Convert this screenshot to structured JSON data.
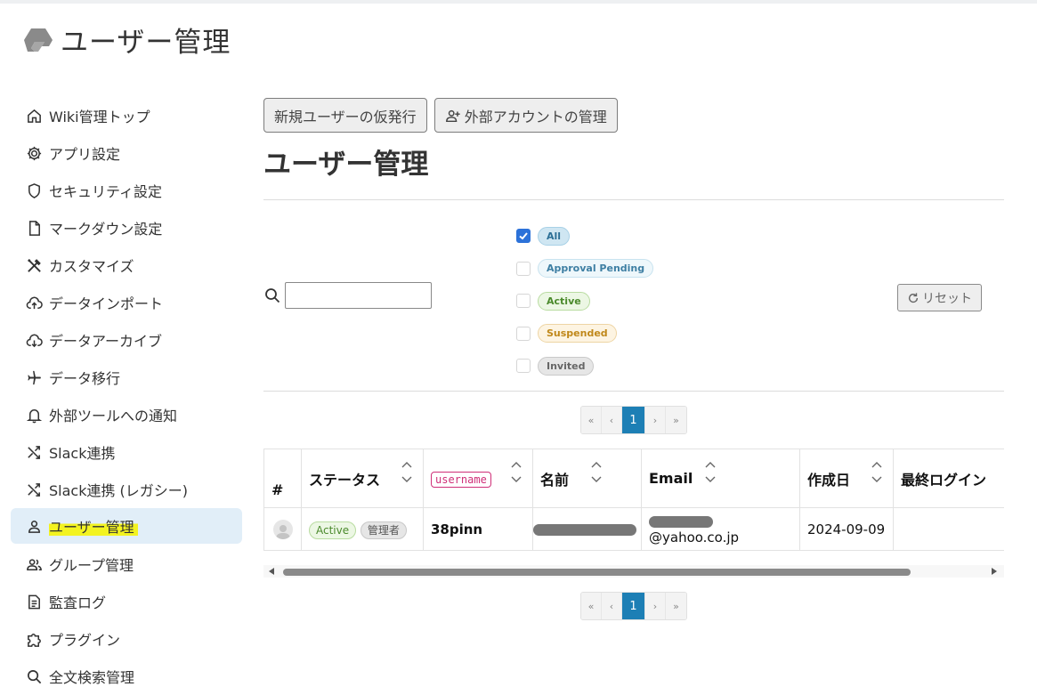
{
  "app": {
    "title": "ユーザー管理"
  },
  "sidebar": {
    "items": [
      {
        "label": "Wiki管理トップ",
        "icon": "home-icon"
      },
      {
        "label": "アプリ設定",
        "icon": "gear-icon"
      },
      {
        "label": "セキュリティ設定",
        "icon": "shield-icon"
      },
      {
        "label": "マークダウン設定",
        "icon": "file-icon"
      },
      {
        "label": "カスタマイズ",
        "icon": "tools-icon"
      },
      {
        "label": "データインポート",
        "icon": "cloud-upload-icon"
      },
      {
        "label": "データアーカイブ",
        "icon": "cloud-download-icon"
      },
      {
        "label": "データ移行",
        "icon": "airplane-icon"
      },
      {
        "label": "外部ツールへの通知",
        "icon": "bell-icon"
      },
      {
        "label": "Slack連携",
        "icon": "shuffle-icon"
      },
      {
        "label": "Slack連携 (レガシー)",
        "icon": "shuffle-icon"
      },
      {
        "label": "ユーザー管理",
        "icon": "user-icon",
        "active": true
      },
      {
        "label": "グループ管理",
        "icon": "group-icon"
      },
      {
        "label": "監査ログ",
        "icon": "log-icon"
      },
      {
        "label": "プラグイン",
        "icon": "puzzle-icon"
      },
      {
        "label": "全文検索管理",
        "icon": "search-icon"
      }
    ]
  },
  "main": {
    "buttons": {
      "invite": "新規ユーザーの仮発行",
      "external": "外部アカウントの管理"
    },
    "title": "ユーザー管理",
    "search": {
      "value": "",
      "placeholder": ""
    },
    "status_filters": [
      {
        "label": "All",
        "checked": true,
        "kind": "all"
      },
      {
        "label": "Approval Pending",
        "checked": false,
        "kind": "pending"
      },
      {
        "label": "Active",
        "checked": false,
        "kind": "active"
      },
      {
        "label": "Suspended",
        "checked": false,
        "kind": "suspended"
      },
      {
        "label": "Invited",
        "checked": false,
        "kind": "invited"
      }
    ],
    "reset_label": "リセット",
    "pagination": {
      "first": "«",
      "prev": "‹",
      "current": "1",
      "next": "›",
      "last": "»"
    },
    "table": {
      "headers": {
        "hash": "#",
        "status": "ステータス",
        "username": "username",
        "name": "名前",
        "email": "Email",
        "created": "作成日",
        "last_login": "最終ログイン"
      },
      "rows": [
        {
          "status": "Active",
          "role": "管理者",
          "username": "38pinn",
          "email_visible": "@yahoo.co.jp",
          "created": "2024-09-09",
          "last_login": ""
        }
      ]
    }
  },
  "colors": {
    "accent": "#1d7fb5",
    "active_sidebar_bg": "#e1eef8",
    "highlight": "#f3f320",
    "checkbox": "#2c72d9",
    "username_pill": "#cf2f78"
  }
}
